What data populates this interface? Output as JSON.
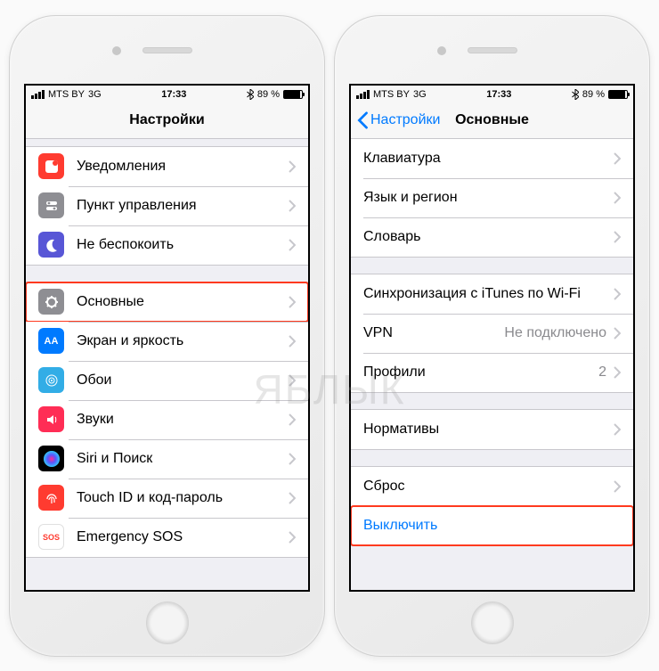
{
  "status": {
    "carrier": "MTS BY",
    "network": "3G",
    "time": "17:33",
    "bluetooth_icon": "bt",
    "battery_pct": "89 %"
  },
  "left": {
    "nav_title": "Настройки",
    "group1": [
      {
        "label": "Уведомления"
      },
      {
        "label": "Пункт управления"
      },
      {
        "label": "Не беспокоить"
      }
    ],
    "group2": [
      {
        "label": "Основные"
      },
      {
        "label": "Экран и яркость"
      },
      {
        "label": "Обои"
      },
      {
        "label": "Звуки"
      },
      {
        "label": "Siri и Поиск"
      },
      {
        "label": "Touch ID и код-пароль"
      },
      {
        "label": "Emergency SOS"
      }
    ]
  },
  "right": {
    "nav_back": "Настройки",
    "nav_title": "Основные",
    "group1": [
      {
        "label": "Клавиатура"
      },
      {
        "label": "Язык и регион"
      },
      {
        "label": "Словарь"
      }
    ],
    "group2": [
      {
        "label": "Синхронизация с iTunes по Wi-Fi"
      },
      {
        "label": "VPN",
        "value": "Не подключено"
      },
      {
        "label": "Профили",
        "value": "2"
      }
    ],
    "group3": [
      {
        "label": "Нормативы"
      }
    ],
    "group4": [
      {
        "label": "Сброс"
      },
      {
        "label": "Выключить",
        "link": true
      }
    ]
  },
  "watermark": "ЯБЛЫК"
}
